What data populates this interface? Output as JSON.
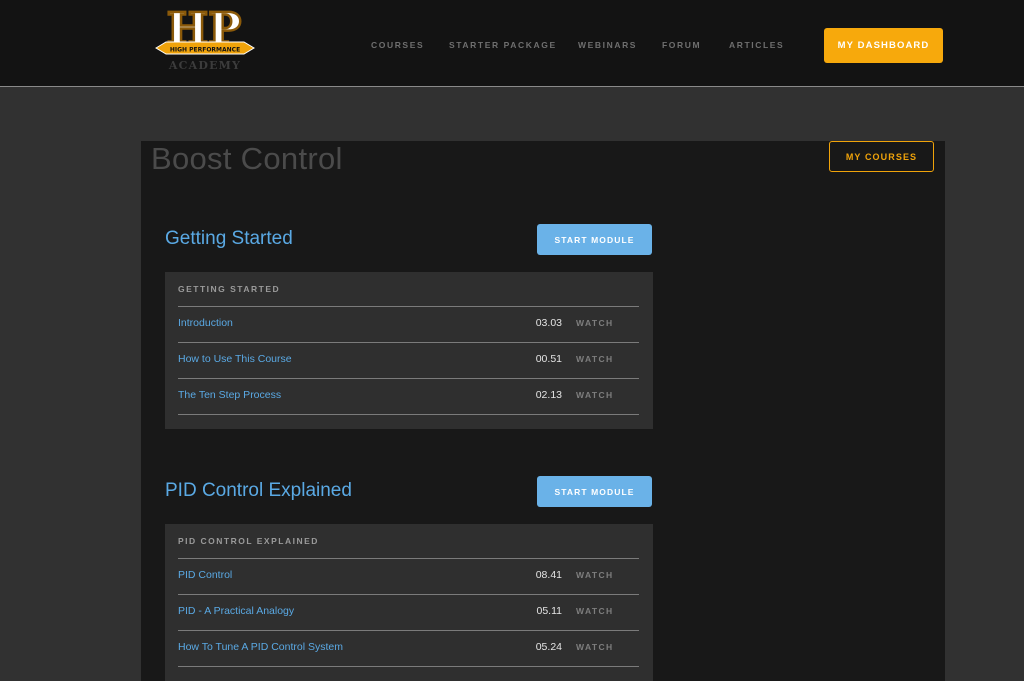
{
  "header": {
    "logo": {
      "letters": "HP",
      "banner": "HIGH PERFORMANCE",
      "sub": "ACADEMY"
    },
    "nav": [
      "COURSES",
      "STARTER PACKAGE",
      "WEBINARS",
      "FORUM",
      "ARTICLES"
    ],
    "dashboard_label": "MY DASHBOARD"
  },
  "page": {
    "title": "Boost Control",
    "my_courses_label": "MY COURSES"
  },
  "modules": [
    {
      "title": "Getting Started",
      "start_label": "START MODULE",
      "box_heading": "GETTING STARTED",
      "lessons": [
        {
          "title": "Introduction",
          "duration": "03.03",
          "action": "WATCH"
        },
        {
          "title": "How to Use This Course",
          "duration": "00.51",
          "action": "WATCH"
        },
        {
          "title": "The Ten Step Process",
          "duration": "02.13",
          "action": "WATCH"
        }
      ]
    },
    {
      "title": "PID Control Explained",
      "start_label": "START MODULE",
      "box_heading": "PID CONTROL EXPLAINED",
      "lessons": [
        {
          "title": "PID Control",
          "duration": "08.41",
          "action": "WATCH"
        },
        {
          "title": "PID - A Practical Analogy",
          "duration": "05.11",
          "action": "WATCH"
        },
        {
          "title": "How To Tune A PID Control System",
          "duration": "05.24",
          "action": "WATCH"
        }
      ]
    }
  ],
  "colors": {
    "accent": "#f7a90c",
    "link": "#5aa9e4",
    "button_blue": "#6ab2e8"
  }
}
